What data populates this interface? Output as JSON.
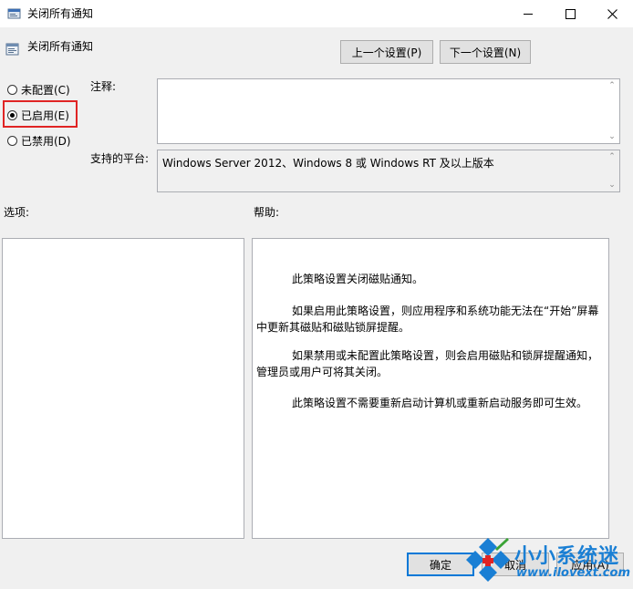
{
  "window": {
    "title": "关闭所有通知",
    "controls": {
      "minimize": "—",
      "maximize": "□",
      "close": "✕"
    }
  },
  "header": {
    "policy_name": "关闭所有通知",
    "prev_button": "上一个设置(P)",
    "next_button": "下一个设置(N)"
  },
  "state": {
    "options": [
      {
        "label": "未配置(C)",
        "checked": false
      },
      {
        "label": "已启用(E)",
        "checked": true
      },
      {
        "label": "已禁用(D)",
        "checked": false
      }
    ]
  },
  "comment": {
    "label": "注释:",
    "value": ""
  },
  "platform": {
    "label": "支持的平台:",
    "value": "Windows Server 2012、Windows 8 或 Windows RT 及以上版本"
  },
  "options_section": {
    "label": "选项:"
  },
  "help_section": {
    "label": "帮助:",
    "paragraphs": [
      "此策略设置关闭磁贴通知。",
      "如果启用此策略设置，则应用程序和系统功能无法在“开始”屏幕中更新其磁贴和磁贴锁屏提醒。",
      "如果禁用或未配置此策略设置，则会启用磁贴和锁屏提醒通知，管理员或用户可将其关闭。",
      "此策略设置不需要重新启动计算机或重新启动服务即可生效。"
    ]
  },
  "footer": {
    "ok_button": "确定",
    "cancel_button": "取消",
    "apply_button": "应用(A)"
  },
  "watermark": {
    "brand": "小小系统迷",
    "url": "www.ilovext.com"
  },
  "colors": {
    "highlight_box": "#e02424",
    "watermark_blue": "#1a7fd4"
  }
}
